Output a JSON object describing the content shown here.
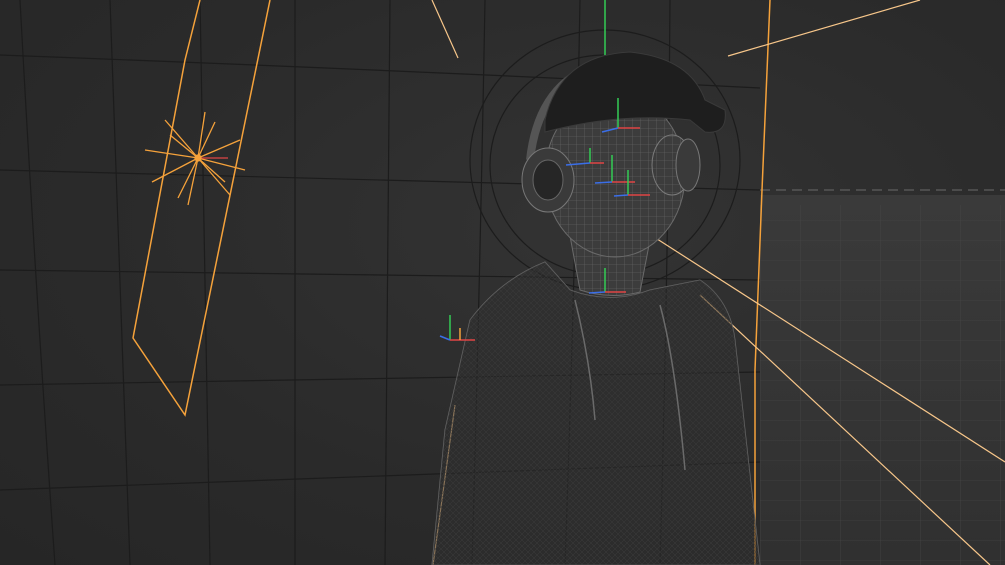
{
  "app": {
    "title": ""
  },
  "viewport": {
    "background_color": "#2b2b2b",
    "grid_color": "#1a1a1a",
    "selection_color": "#f5a23b",
    "light_line_color": "#f7c68a",
    "gizmo_x_color": "#e04545",
    "gizmo_y_color": "#33cc55",
    "gizmo_z_color": "#3a6ee8",
    "mesh_wire_color": "#5a5a5a",
    "icons": [
      "sun-light-icon",
      "area-light-icon",
      "transform-gizmo-icon",
      "camera-frame-icon"
    ]
  }
}
